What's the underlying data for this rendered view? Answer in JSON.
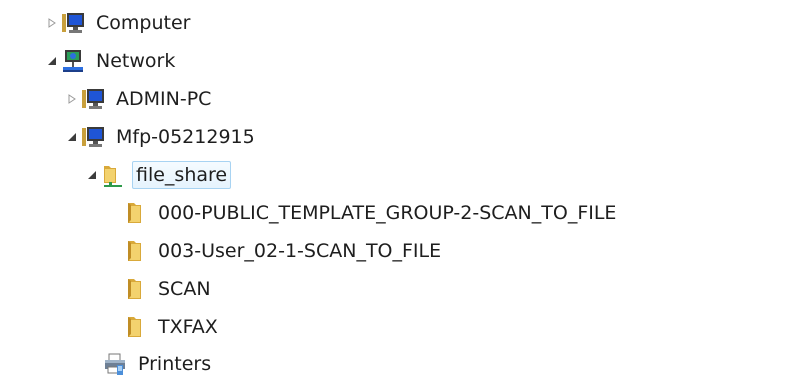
{
  "tree": {
    "items": [
      {
        "label": "Computer",
        "icon": "computer-icon",
        "expander": "collapsed"
      },
      {
        "label": "Network",
        "icon": "network-icon",
        "expander": "expanded"
      },
      {
        "label": "ADMIN-PC",
        "icon": "computer-icon",
        "expander": "collapsed"
      },
      {
        "label": "Mfp-05212915",
        "icon": "computer-icon",
        "expander": "expanded"
      },
      {
        "label": "file_share",
        "icon": "shared-folder-icon",
        "expander": "expanded",
        "selected": true
      },
      {
        "label": "000-PUBLIC_TEMPLATE_GROUP-2-SCAN_TO_FILE",
        "icon": "folder-icon",
        "expander": "none"
      },
      {
        "label": "003-User_02-1-SCAN_TO_FILE",
        "icon": "folder-icon",
        "expander": "none"
      },
      {
        "label": "SCAN",
        "icon": "folder-icon",
        "expander": "none"
      },
      {
        "label": "TXFAX",
        "icon": "folder-icon",
        "expander": "none"
      },
      {
        "label": "Printers",
        "icon": "printer-icon",
        "expander": "none"
      }
    ]
  },
  "colors": {
    "selection_fill": "#e6f3fd",
    "selection_border": "#a8d3f2",
    "folder": "#e8c45a",
    "monitor_screen": "#1f55d6"
  }
}
